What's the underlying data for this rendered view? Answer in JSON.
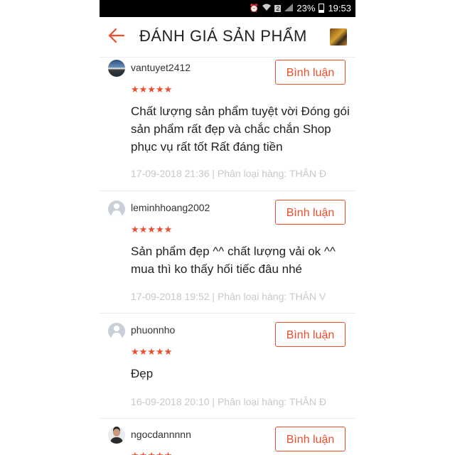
{
  "status_bar": {
    "icons": [
      "alarm-icon",
      "wifi-icon",
      "sim2-icon",
      "signal-icon"
    ],
    "sim_label": "2",
    "battery": "23%",
    "time": "19:53"
  },
  "header": {
    "title": "ĐÁNH GIÁ SẢN PHẨM",
    "back_icon": "arrow-left-icon"
  },
  "accent_color": "#ee4d2d",
  "reviews": [
    {
      "user": "vantuyet2412",
      "stars": "★★★★★",
      "rating": 5,
      "button": "Bình luận",
      "comment": "Chất lượng sản phẩm tuyệt vời Đóng gói sản phẩm rất đẹp và chắc chắn Shop phục vụ rất tốt Rất đáng tiền",
      "meta": "17-09-2018 21:36 |  Phân loại hàng:  THÂN Đ"
    },
    {
      "user": "leminhhoang2002",
      "stars": "★★★★★",
      "rating": 5,
      "button": "Bình luận",
      "comment": "Sản phẩm đẹp ^^ chất lượng vải ok ^^ mua thì ko thấy hối tiếc đâu nhé",
      "meta": "17-09-2018 19:52 |  Phân loại hàng:  THÂN V"
    },
    {
      "user": "phuonnho",
      "stars": "★★★★★",
      "rating": 5,
      "button": "Bình luận",
      "comment": "Đẹp",
      "meta": "16-09-2018 20:10 |  Phân loại hàng:  THÂN Đ"
    },
    {
      "user": "ngocdannnnn",
      "stars": "★★★★★",
      "rating": 5,
      "button": "Bình luận",
      "comment": "",
      "meta": ""
    }
  ]
}
